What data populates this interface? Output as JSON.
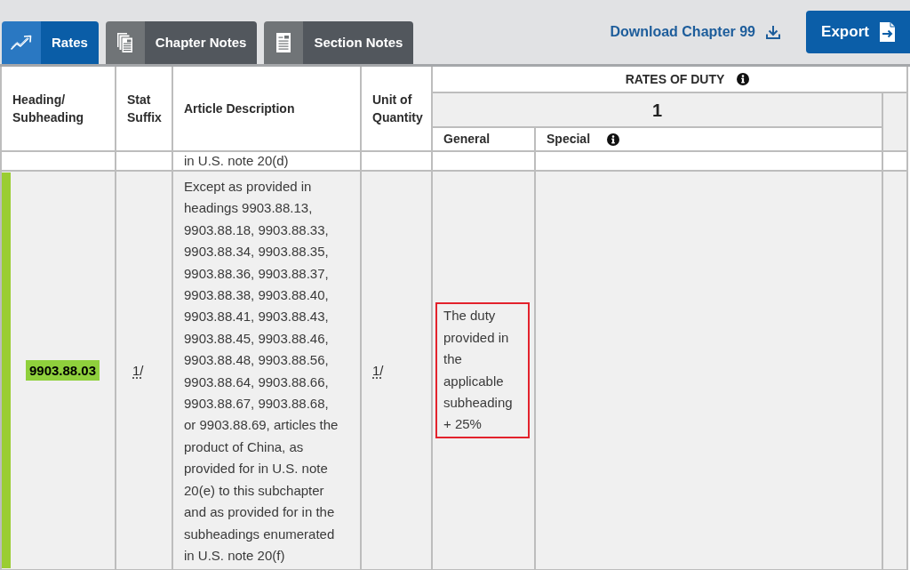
{
  "tabs": [
    {
      "label": "Rates",
      "selected": true
    },
    {
      "label": "Chapter Notes",
      "selected": false
    },
    {
      "label": "Section Notes",
      "selected": false
    }
  ],
  "download_link": {
    "label": "Download Chapter 99"
  },
  "export_button": {
    "label": "Export"
  },
  "table": {
    "columns": [
      "Heading/ Subheading",
      "Stat Suffix",
      "Article Description",
      "Unit of Quantity"
    ],
    "rates_of_duty": {
      "label": "RATES OF DUTY",
      "info": true,
      "column_1": "1",
      "subcolumns": [
        {
          "label": "General",
          "info": false
        },
        {
          "label": "Special",
          "info": true
        }
      ]
    },
    "rows": [
      {
        "kind": "partial",
        "description": "in U.S. note 20(d)"
      },
      {
        "kind": "full",
        "highlighted": true,
        "heading": "9903.88.03",
        "stat_suffix": "1/",
        "description": "Except as provided in headings 9903.88.13, 9903.88.18, 9903.88.33, 9903.88.34, 9903.88.35, 9903.88.36, 9903.88.37, 9903.88.38, 9903.88.40, 9903.88.41, 9903.88.43, 9903.88.45, 9903.88.46, 9903.88.48, 9903.88.56, 9903.88.64, 9903.88.66, 9903.88.67, 9903.88.68, or 9903.88.69, articles the product of China, as provided for in U.S. note 20(e) to this subchapter and as provided for in the subheadings enumerated in U.S. note 20(f)",
        "unit": "1/",
        "general": "The duty provided in the applicable subheading + 25%",
        "general_outlined": true
      }
    ]
  }
}
